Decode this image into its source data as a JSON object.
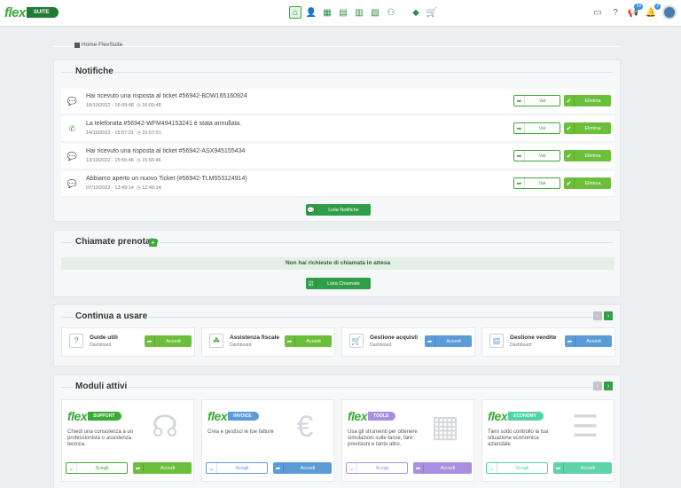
{
  "header": {
    "logo_word": "flex",
    "logo_suite": "SUITE",
    "nav_icons": [
      "home-icon",
      "user-icon",
      "calculator-icon",
      "invoice-icon",
      "chart-icon",
      "document-icon",
      "person-tree-icon",
      "tag-icon",
      "cart-icon"
    ],
    "right_icons": [
      "video-icon",
      "help-icon",
      "megaphone-icon",
      "bell-icon"
    ],
    "megaphone_badge": "19",
    "bell_badge": "2"
  },
  "breadcrumb": {
    "label": "Home FlexSuite"
  },
  "notifiche": {
    "title": "Notifiche",
    "items": [
      {
        "icon": "chat-icon",
        "text": "Hai ricevuto una risposta al ticket #56942-BDW165160924",
        "date": "18/10/2022 - 16:09:48",
        "time": "16:09:48"
      },
      {
        "icon": "phone-icon",
        "text": "La telefonata #56942-WFM494153241 è stata annullata.",
        "date": "14/10/2022 - 15:57:01",
        "time": "15:57:01"
      },
      {
        "icon": "chat-icon",
        "text": "Hai ricevuto una risposta al ticket #56942-ASX945155434",
        "date": "13/10/2022 - 15:56:46",
        "time": "15:56:46"
      },
      {
        "icon": "chat-icon",
        "text": "Abbiamo aperto un nuovo Ticket (#56942-TLM553124914)",
        "date": "07/10/2022 - 12:49:14",
        "time": "12:49:14"
      }
    ],
    "vai_label": "Vai",
    "elimina_label": "Elimina",
    "lista_label": "Lista Notifiche"
  },
  "chiamate": {
    "title": "Chiamate prenotate",
    "add": "+",
    "empty": "Non hai richieste di chiamata in attesa",
    "lista_label": "Lista Chiamate"
  },
  "continua": {
    "title": "Continua a usare",
    "cards": [
      {
        "title": "Guide utili",
        "sub": "Dashboard",
        "btn": "Accedi",
        "color": "#6cbf3a",
        "icon": "?"
      },
      {
        "title": "Assistenza fiscale",
        "sub": "Dashboard",
        "btn": "Accedi",
        "color": "#6cbf3a",
        "icon": "☘"
      },
      {
        "title": "Gestione acquisti",
        "sub": "Dashboard",
        "btn": "Accedi",
        "color": "#5b9bd8",
        "icon": "🛒"
      },
      {
        "title": "Gestione vendite",
        "sub": "Dashboard",
        "btn": "Accedi",
        "color": "#5b9bd8",
        "icon": "▤"
      }
    ]
  },
  "moduli": {
    "title": "Moduli attivi",
    "cards": [
      {
        "word": "flex",
        "tag": "SUPPORT",
        "word_color": "#3aa935",
        "tag_color": "#3aa935",
        "desc": "Chiedi una consulenza a un professionista o assistenza tecnica.",
        "scegli": "Scegli",
        "accedi": "Accedi",
        "color": "#6cbf3a",
        "ill": "☊"
      },
      {
        "word": "flex",
        "tag": "INVOICE",
        "word_color": "#3aa935",
        "tag_color": "#5b9bd8",
        "desc": "Crea e gestisci le tue fatture",
        "scegli": "Scegli",
        "accedi": "Accedi",
        "color": "#5b9bd8",
        "ill": "€"
      },
      {
        "word": "flex",
        "tag": "TOOLS",
        "word_color": "#3aa935",
        "tag_color": "#a98fe0",
        "desc": "Usa gli strumenti per ottenere simulazioni sulle tasse, fare previsioni e tanto altro.",
        "scegli": "Scegli",
        "accedi": "Accedi",
        "color": "#a98fe0",
        "ill": "▦"
      },
      {
        "word": "flex",
        "tag": "ECONOMY",
        "word_color": "#3aa935",
        "tag_color": "#4fd3a8",
        "desc": "Tieni sotto controllo la tua situazione economica aziendale",
        "scegli": "Scegli",
        "accedi": "Accedi",
        "color": "#5ed3a8",
        "ill": "☰"
      }
    ]
  }
}
